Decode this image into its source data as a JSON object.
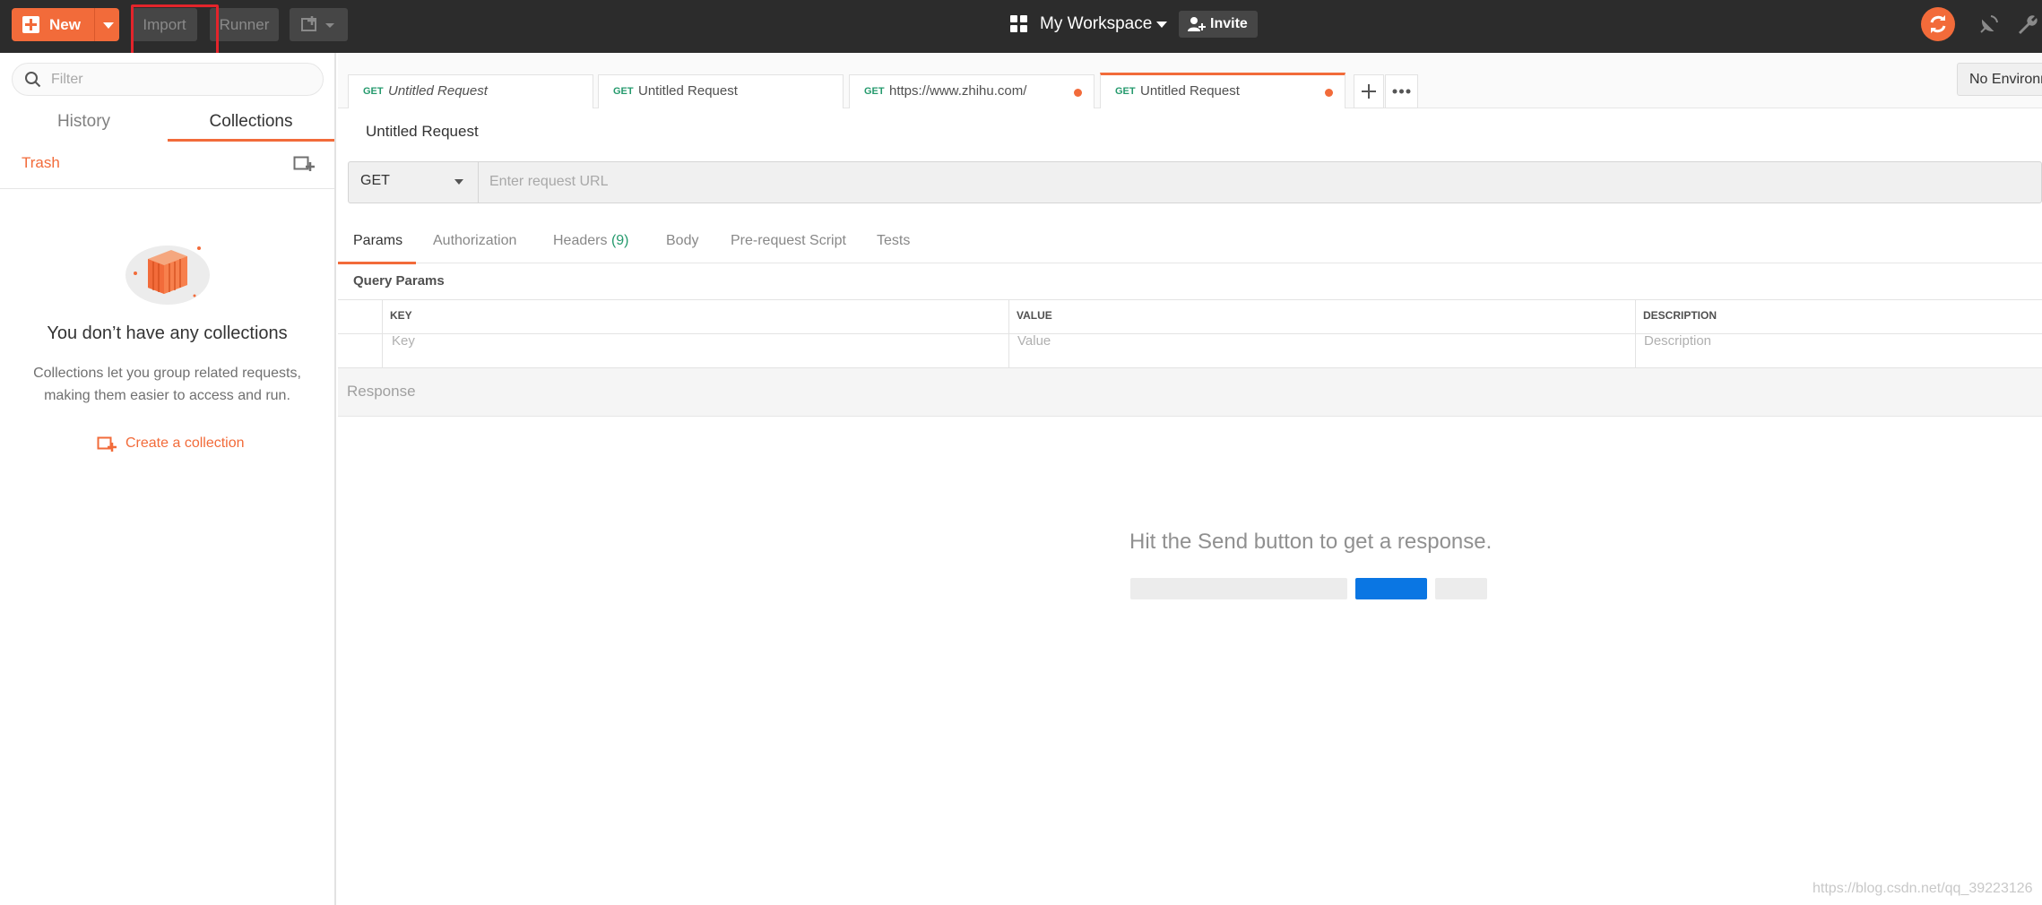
{
  "toolbar": {
    "new_label": "New",
    "import_label": "Import",
    "runner_label": "Runner",
    "workspace_label": "My Workspace",
    "invite_label": "Invite"
  },
  "sidebar": {
    "filter_placeholder": "Filter",
    "tabs": [
      {
        "label": "History",
        "active": false
      },
      {
        "label": "Collections",
        "active": true
      }
    ],
    "trash_label": "Trash",
    "empty_title": "You don’t have any collections",
    "empty_desc": "Collections let you group related requests, making them easier to access and run.",
    "create_collection_label": "Create a collection"
  },
  "request_tabs": [
    {
      "method": "GET",
      "title": "Untitled Request",
      "italic": true,
      "unsaved": false,
      "active": false
    },
    {
      "method": "GET",
      "title": "Untitled Request",
      "italic": false,
      "unsaved": false,
      "active": false
    },
    {
      "method": "GET",
      "title": "https://www.zhihu.com/",
      "italic": false,
      "unsaved": true,
      "active": false
    },
    {
      "method": "GET",
      "title": "Untitled Request",
      "italic": false,
      "unsaved": true,
      "active": true
    }
  ],
  "environment": {
    "selected": "No Environment"
  },
  "request": {
    "title": "Untitled Request",
    "method": "GET",
    "url_placeholder": "Enter request URL"
  },
  "subtabs": [
    {
      "label": "Params",
      "count": "",
      "active": true
    },
    {
      "label": "Authorization",
      "count": "",
      "active": false
    },
    {
      "label": "Headers",
      "count": "(9)",
      "active": false
    },
    {
      "label": "Body",
      "count": "",
      "active": false
    },
    {
      "label": "Pre-request Script",
      "count": "",
      "active": false
    },
    {
      "label": "Tests",
      "count": "",
      "active": false
    }
  ],
  "params": {
    "title": "Query Params",
    "headers": [
      "KEY",
      "VALUE",
      "DESCRIPTION"
    ],
    "placeholders": [
      "Key",
      "Value",
      "Description"
    ]
  },
  "response": {
    "label": "Response",
    "hint": "Hit the Send button to get a response."
  },
  "watermark": "https://blog.csdn.net/qq_39223126",
  "colors": {
    "accent": "#f26b3a",
    "topbar": "#2c2c2c",
    "method_green": "#259a6d",
    "send_blue": "#0a76e3",
    "highlight_red": "#e3242b"
  }
}
